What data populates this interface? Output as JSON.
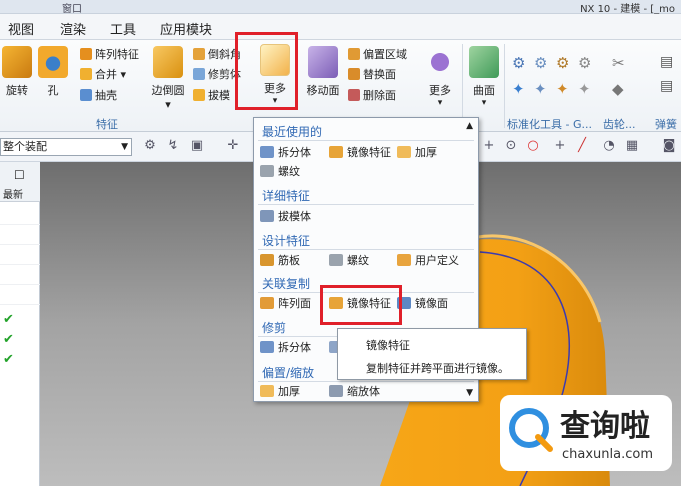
{
  "titlebar": {
    "qa_label": "窗口",
    "title": "NX 10 - 建模 - [_mo"
  },
  "menu": [
    "视图",
    "渲染",
    "工具",
    "应用模块"
  ],
  "ribbon": {
    "rotate_label": "旋转",
    "hole_label": "孔",
    "array_feature": "阵列特征",
    "combine": "合并",
    "shell": "抽壳",
    "edge_blend": "边倒圆",
    "chamfer": "倒斜角",
    "trim_body": "修剪体",
    "draft": "拔模",
    "more_label": "更多",
    "move_face": "移动面",
    "offset_region": "偏置区域",
    "replace_face": "替换面",
    "delete_face": "删除面",
    "more2_label": "更多",
    "surface_label": "曲面",
    "feature_group": "特征",
    "std_tools_group": "标准化工具 - G...",
    "gear_group": "齿轮...",
    "spring_group": "弹簧"
  },
  "toolbar": {
    "assembly_value": "整个装配"
  },
  "navigator": {
    "header_label": "最新",
    "checks": [
      "✔",
      "✔",
      "✔"
    ]
  },
  "dropdown": {
    "sec_recent": "最近使用的",
    "split_body": "拆分体",
    "mirror_feature": "镜像特征",
    "thicken": "加厚",
    "thread": "螺纹",
    "sec_detail": "详细特征",
    "draft_body": "拔模体",
    "sec_design": "设计特征",
    "rib": "筋板",
    "thread2": "螺纹",
    "user_defined": "用户定义",
    "sec_assoc_copy": "关联复制",
    "pattern_face": "阵列面",
    "mirror_feature2": "镜像特征",
    "mirror_face": "镜像面",
    "sec_trim": "修剪",
    "split_body2": "拆分体",
    "trim_partial": "修",
    "sec_offset_scale": "偏置/缩放",
    "thicken2": "加厚",
    "scale_body": "缩放体"
  },
  "tooltip": {
    "title": "镜像特征",
    "desc": "复制特征并跨平面进行镜像。"
  },
  "watermark": {
    "brand_cn": "查询啦",
    "brand_url": "chaxunla.com"
  },
  "colors": {
    "highlight_red": "#e0202a",
    "section_blue": "#3169b4",
    "part_orange": "#f39a10"
  }
}
